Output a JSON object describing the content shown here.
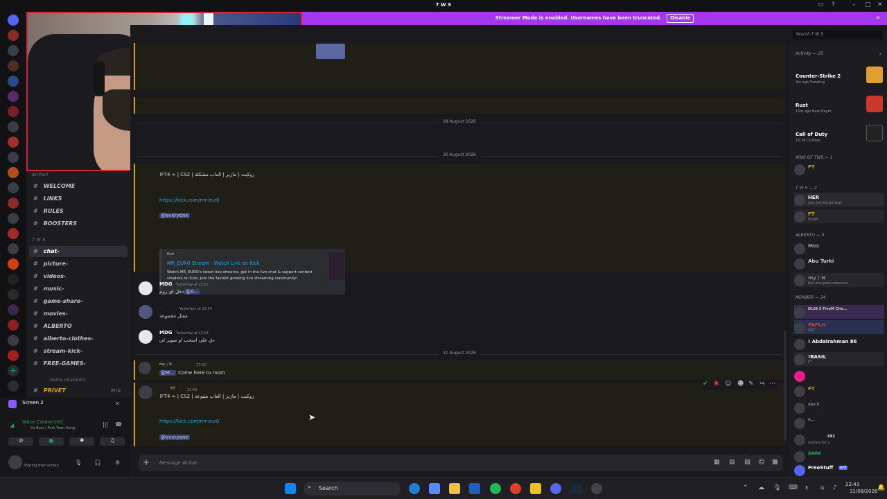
{
  "window": {
    "title": "T W S"
  },
  "banner": {
    "text": "Streamer Mode is enabled. Usernames have been truncated.",
    "disable_label": "Disable"
  },
  "header": {
    "search_placeholder": "Search T W S"
  },
  "channels": {
    "category_top": "AirPort",
    "info": [
      {
        "label": "WELCOME"
      },
      {
        "label": "LINKS"
      },
      {
        "label": "RULES"
      },
      {
        "label": "BOOSTERS"
      }
    ],
    "category_tws": "T W S",
    "list": [
      {
        "label": "chat-"
      },
      {
        "label": "picture-"
      },
      {
        "label": "videos-"
      },
      {
        "label": "music-"
      },
      {
        "label": "game-share-"
      },
      {
        "label": "movies-"
      },
      {
        "label": "ALBERTO"
      },
      {
        "label": "alberto-clothes-"
      },
      {
        "label": "stream-kick-"
      },
      {
        "label": "FREE-GAMES-"
      }
    ],
    "voice_category": "Voice channels",
    "voice_channel": "PRIVET",
    "voice_time": "00  02"
  },
  "user_panel": {
    "screen_title": "Screen 2",
    "voice_status": "Voice Connected",
    "voice_location": "Co Boss / First Town Gang",
    "sharing": "Sharing their screen"
  },
  "chat": {
    "dates": [
      "28 August 2026",
      "30 August 2026",
      "31 August 2026"
    ],
    "pinned_msg": {
      "text": "!FT4 ∞ | CS2 | زوكيت | مازيز | العاب مشكلة",
      "link": "https://kick.com/mr-eur0",
      "mention": "@everyone",
      "embed_provider": "Kick",
      "embed_title": "MR_EUR0 Stream - Watch Live on Kick",
      "embed_desc": "Watch MR_EURO's latest live streams, get in the live chat & support content creators on Kick. Join the fastest growing live streaming community!"
    },
    "messages": [
      {
        "user": "MDG",
        "time": "Yesterday at 23:52",
        "text": "ادخل اي روم",
        "mention": "@A..."
      },
      {
        "user": "",
        "time": "Yesterday at 23:54",
        "text": "مقتل مجموعة"
      },
      {
        "user": "MDG",
        "time": "Yesterday at 23:54",
        "text": "دق علي اسحب او صوبر لي"
      },
      {
        "user": "my | N",
        "time": "17:51",
        "mention": "@M...",
        "text": "Come here to room"
      },
      {
        "user": "FT",
        "time": "22:43",
        "text": "!FT4 ∞ | CS2 | زوكيت | مازيز | العاب متنوعة",
        "link": "https://kick.com/mr-eur0",
        "mention2": "@everyone"
      }
    ],
    "composer_placeholder": "Message #chat-"
  },
  "members": {
    "activity_header": "Activity — 25",
    "activities": [
      {
        "game": "Counter-Strike 2",
        "meta": "3m ago  Trending",
        "color": "#e0a030"
      },
      {
        "game": "Rust",
        "meta": "10m ago  New Player",
        "color": "#c8392b"
      },
      {
        "game": "Call of Duty",
        "meta": "15:38  Co Boss",
        "color": "#222222"
      }
    ],
    "sections": [
      {
        "title": "KING OF TWS — 1"
      },
      {
        "title": "T W S — 2"
      },
      {
        "title": "ALBERTO — 3"
      },
      {
        "title": "MEMBER — 24"
      }
    ],
    "names": [
      "FT",
      "HER",
      "FT",
      "Mes",
      "Abu Turki",
      "my | N",
      "DLSS 5 FiveM Che...",
      "PAPLO",
      "! Abdalrahman 86",
      "!BASIL",
      "FT",
      "Abo K",
      "A...",
      "SX1",
      "DARK",
      "FreeStuff"
    ],
    "subs": [
      "you are the air that",
      "FiveM",
      "Not everyone deserves",
      "SN7",
      "FT",
      "waiting for u",
      "APP"
    ]
  },
  "taskbar": {
    "search_label": "Search",
    "time": "22:43",
    "date": "31/08/2026"
  },
  "colors": {
    "accent": "#a438f0",
    "highlight": "#d5a32a",
    "link": "#2aa6e0",
    "green": "#23a55a"
  }
}
